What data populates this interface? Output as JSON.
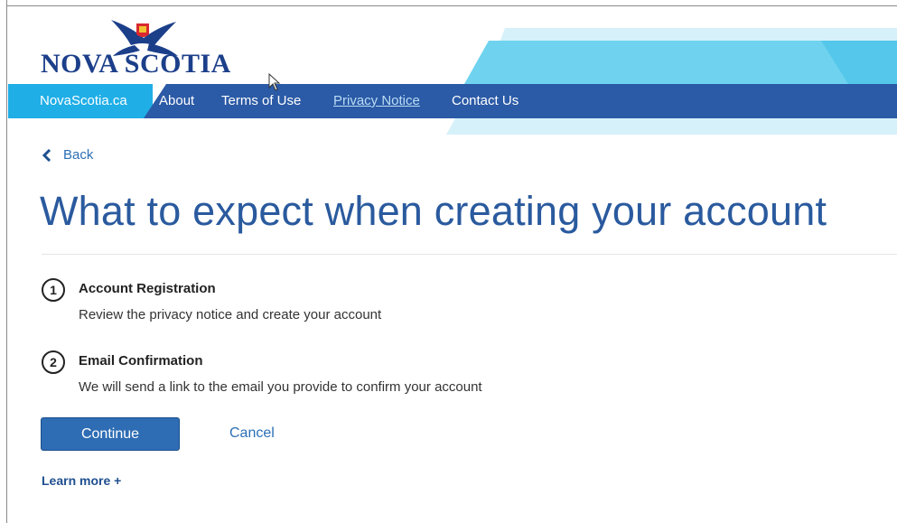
{
  "header": {
    "logo_text": "NOVA SCOTIA"
  },
  "nav": {
    "home": "NovaScotia.ca",
    "about": "About",
    "terms": "Terms of Use",
    "privacy": "Privacy Notice",
    "contact": "Contact Us"
  },
  "back": {
    "label": "Back",
    "icon": "chevron-left-icon"
  },
  "page_title": "What to expect when creating your account",
  "steps": [
    {
      "number": "1",
      "title": "Account Registration",
      "description": "Review the privacy notice and create your account"
    },
    {
      "number": "2",
      "title": "Email Confirmation",
      "description": "We will send a link to the email you provide to confirm your account"
    }
  ],
  "actions": {
    "continue_label": "Continue",
    "cancel_label": "Cancel",
    "learn_more_label": "Learn more +"
  },
  "colors": {
    "nav_blue": "#2b5aa6",
    "nav_cyan": "#1faee6",
    "accent_light": "#66d0ee",
    "title_blue": "#2a5a9e",
    "button_blue": "#2e6db4",
    "link_blue": "#2c6fb5"
  }
}
